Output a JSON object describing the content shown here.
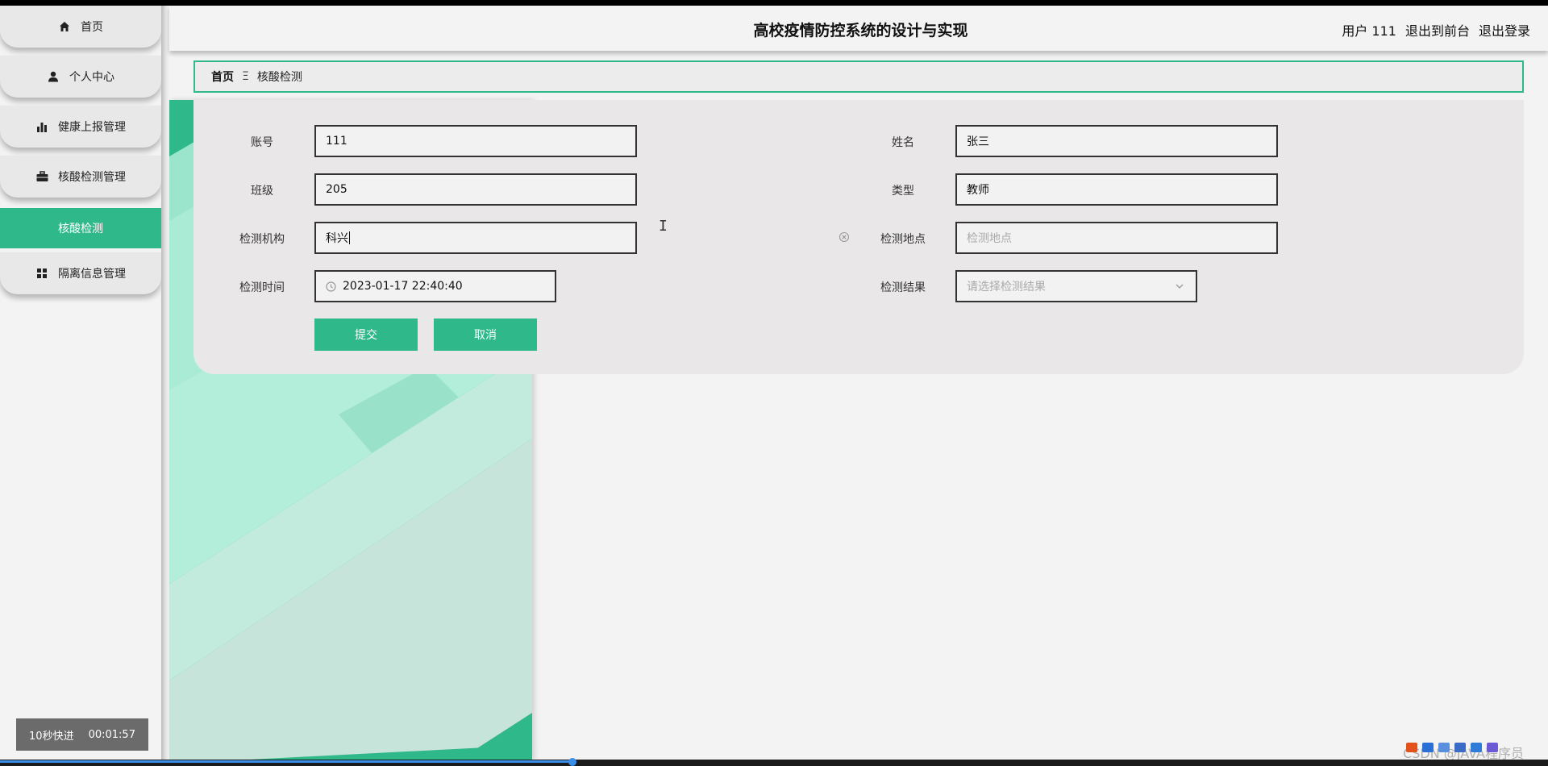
{
  "app": {
    "title": "高校疫情防控系统的设计与实现"
  },
  "header": {
    "user_label": "用户 111",
    "back_to_front": "退出到前台",
    "logout": "退出登录"
  },
  "sidebar": {
    "items": [
      {
        "label": "首页",
        "icon": "home-icon"
      },
      {
        "label": "个人中心",
        "icon": "user-icon"
      },
      {
        "label": "健康上报管理",
        "icon": "bar-chart-icon"
      },
      {
        "label": "核酸检测管理",
        "icon": "briefcase-icon"
      },
      {
        "label": "隔离信息管理",
        "icon": "grid-icon"
      }
    ],
    "active_sub": "核酸检测"
  },
  "breadcrumb": {
    "home": "首页",
    "separator": "Ξ",
    "current": "核酸检测"
  },
  "form": {
    "account_label": "账号",
    "account_value": "111",
    "name_label": "姓名",
    "name_value": "张三",
    "class_label": "班级",
    "class_value": "205",
    "type_label": "类型",
    "type_value": "教师",
    "institution_label": "检测机构",
    "institution_value": "科兴",
    "location_label": "检测地点",
    "location_placeholder": "检测地点",
    "time_label": "检测时间",
    "time_value": "2023-01-17 22:40:40",
    "result_label": "检测结果",
    "result_placeholder": "请选择检测结果",
    "submit": "提交",
    "cancel": "取消"
  },
  "video_overlay": {
    "skip": "10秒快进",
    "time": "00:01:57"
  },
  "watermark": "CSDN @JAVA程序员"
}
